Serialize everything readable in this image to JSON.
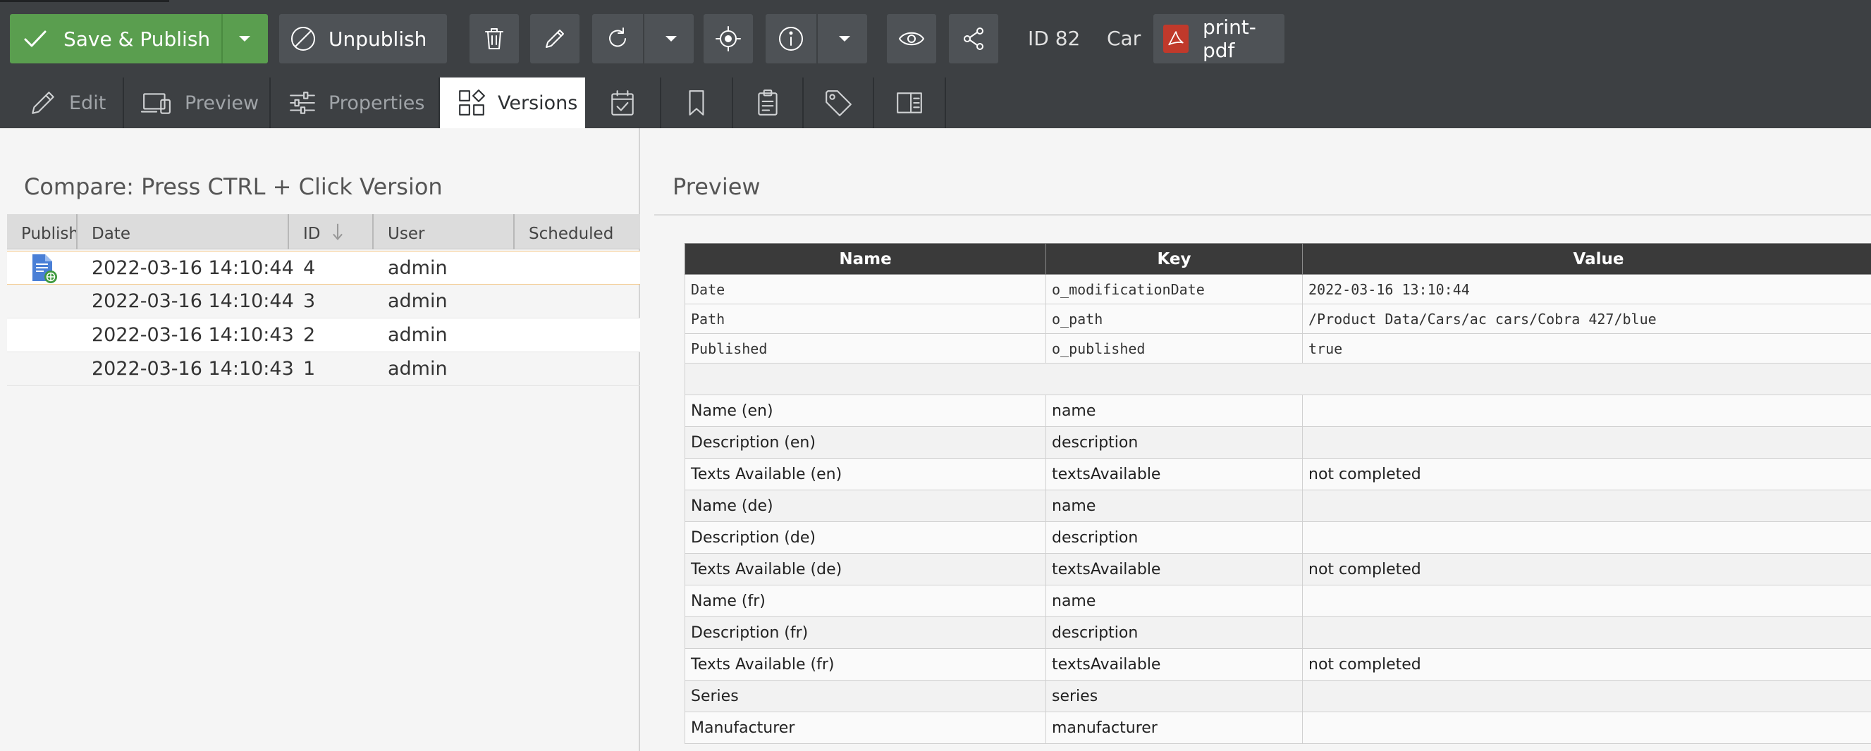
{
  "toolbar": {
    "save_publish_label": "Save & Publish",
    "unpublish_label": "Unpublish",
    "id_text": "ID 82",
    "class_text": "Car",
    "print_pdf_label": "print-pdf"
  },
  "tabs": {
    "edit": "Edit",
    "preview": "Preview",
    "properties": "Properties",
    "versions": "Versions"
  },
  "left_panel": {
    "title": "Compare: Press CTRL + Click Version",
    "columns": [
      "Publish",
      "Date",
      "ID",
      "User",
      "Scheduled"
    ],
    "rows": [
      {
        "date": "2022-03-16 14:10:44",
        "id": "4",
        "user": "admin",
        "published_icon": "published-doc-icon"
      },
      {
        "date": "2022-03-16 14:10:44",
        "id": "3",
        "user": "admin"
      },
      {
        "date": "2022-03-16 14:10:43",
        "id": "2",
        "user": "admin"
      },
      {
        "date": "2022-03-16 14:10:43",
        "id": "1",
        "user": "admin"
      }
    ]
  },
  "right_panel": {
    "title": "Preview",
    "columns": [
      "Name",
      "Key",
      "Value"
    ],
    "system_rows": [
      {
        "name": "Date",
        "key": "o_modificationDate",
        "value": "2022-03-16 13:10:44"
      },
      {
        "name": "Path",
        "key": "o_path",
        "value": "/Product Data/Cars/ac cars/Cobra 427/blue"
      },
      {
        "name": "Published",
        "key": "o_published",
        "value": "true"
      }
    ],
    "field_rows": [
      {
        "name": "Name (en)",
        "key": "name",
        "value": ""
      },
      {
        "name": "Description (en)",
        "key": "description",
        "value": ""
      },
      {
        "name": "Texts Available (en)",
        "key": "textsAvailable",
        "value": "not completed"
      },
      {
        "name": "Name (de)",
        "key": "name",
        "value": ""
      },
      {
        "name": "Description (de)",
        "key": "description",
        "value": ""
      },
      {
        "name": "Texts Available (de)",
        "key": "textsAvailable",
        "value": "not completed"
      },
      {
        "name": "Name (fr)",
        "key": "name",
        "value": ""
      },
      {
        "name": "Description (fr)",
        "key": "description",
        "value": ""
      },
      {
        "name": "Texts Available (fr)",
        "key": "textsAvailable",
        "value": "not completed"
      },
      {
        "name": "Series",
        "key": "series",
        "value": ""
      },
      {
        "name": "Manufacturer",
        "key": "manufacturer",
        "value": ""
      }
    ]
  },
  "colors": {
    "toolbar_bg": "#3d4043",
    "button_bg": "#4e5256",
    "save_green": "#5a9e4f",
    "pdf_red": "#c0392b",
    "table_header_bg": "#3a3a3a",
    "selected_row_border": "#f3c98b"
  }
}
